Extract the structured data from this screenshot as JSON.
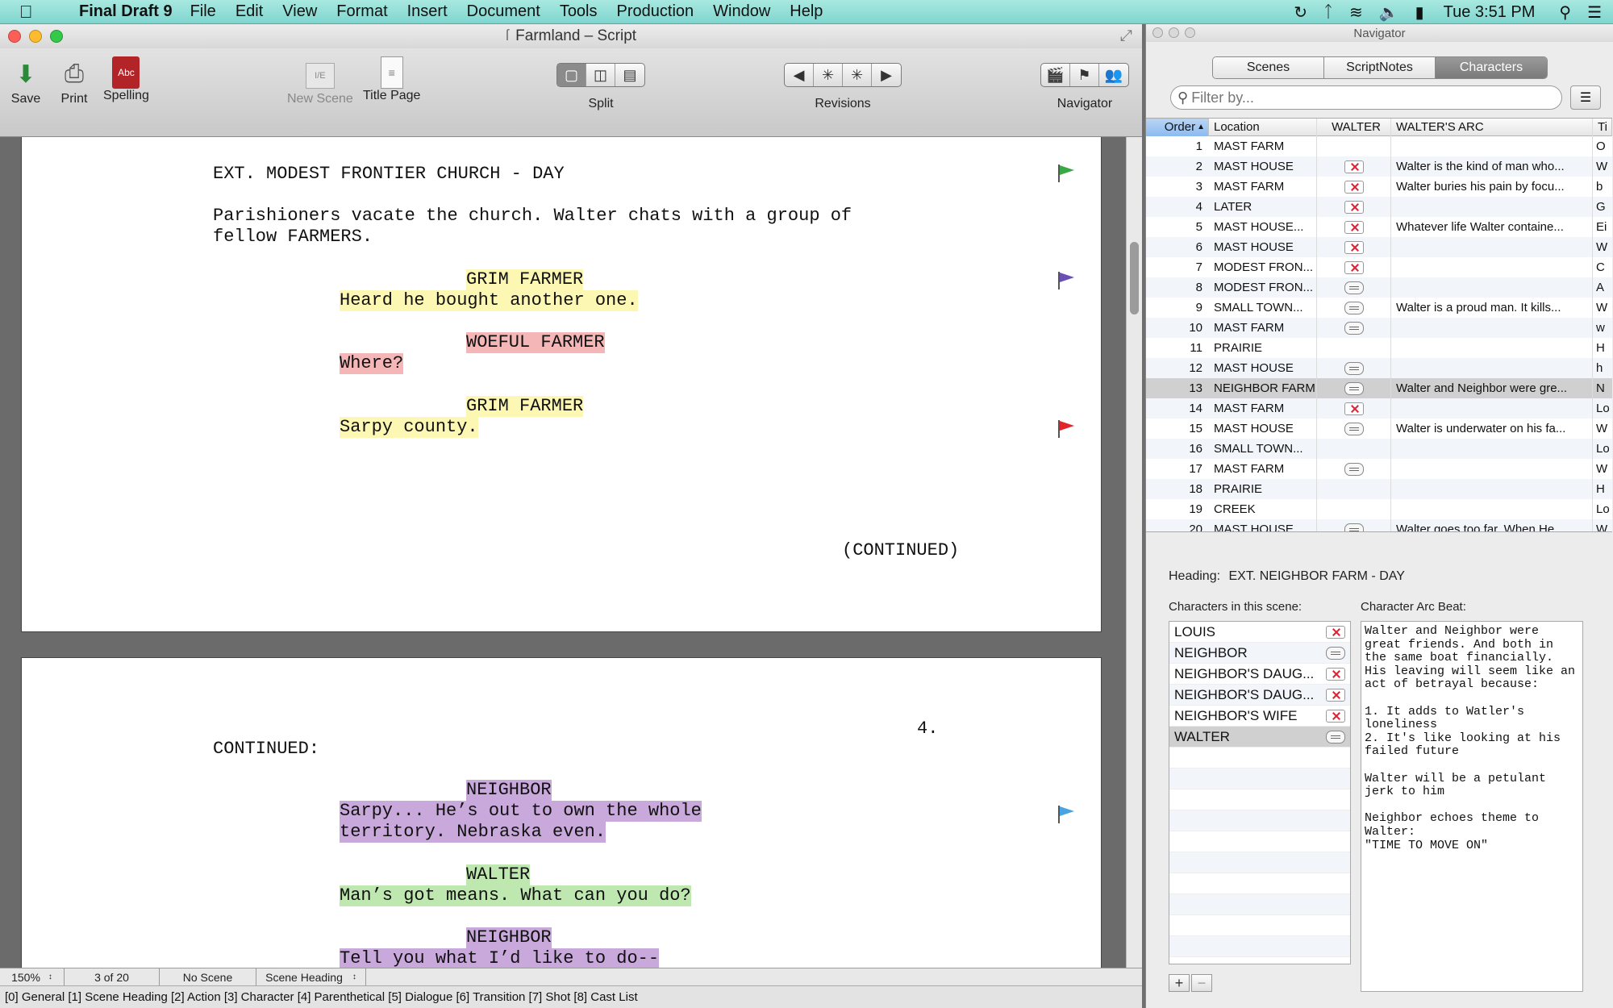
{
  "menubar": {
    "app_name": "Final Draft 9",
    "items": [
      "File",
      "Edit",
      "View",
      "Format",
      "Insert",
      "Document",
      "Tools",
      "Production",
      "Window",
      "Help"
    ],
    "clock": "Tue 3:51 PM"
  },
  "script_window": {
    "title": "Farmland – Script",
    "toolbar": {
      "save": "Save",
      "print": "Print",
      "spelling": "Spelling",
      "new_scene": "New Scene",
      "new_scene_icon_text": "I/E",
      "title_page": "Title Page",
      "split": "Split",
      "revisions": "Revisions",
      "navigator": "Navigator"
    },
    "page1": {
      "heading": "EXT. MODEST FRONTIER CHURCH - DAY",
      "action_1": "Parishioners vacate the church. Walter chats with a group of",
      "action_2": "fellow FARMERS.",
      "char_1": "GRIM FARMER",
      "dial_1": "Heard he bought another one.",
      "char_2": "WOEFUL FARMER",
      "dial_2": "Where?",
      "char_3": "GRIM FARMER",
      "dial_3": "Sarpy county.",
      "continued": "(CONTINUED)",
      "flag_colors": [
        "#3aa845",
        "#6a4fb5",
        "#e0262b"
      ]
    },
    "page2": {
      "page_number": "4.",
      "continued": "CONTINUED:",
      "char_1": "NEIGHBOR",
      "dial_1a": "Sarpy... He’s out to own the whole",
      "dial_1b": "territory. Nebraska even.",
      "char_2": "WALTER",
      "dial_2": "Man’s got means. What can you do?",
      "char_3": "NEIGHBOR",
      "dial_3": "Tell you what I’d like to do--",
      "flag_color": "#4aa3e0"
    },
    "status": {
      "zoom": "150%",
      "page": "3 of 20",
      "scene": "No Scene",
      "element": "Scene Heading"
    },
    "format_bar": "[0] General [1] Scene Heading [2] Action [3] Character [4] Parenthetical [5] Dialogue [6] Transition [7] Shot [8] Cast List"
  },
  "navigator": {
    "title": "Navigator",
    "tabs": [
      "Scenes",
      "ScriptNotes",
      "Characters"
    ],
    "active_tab": "Characters",
    "filter_placeholder": "Filter by...",
    "columns": [
      "Order",
      "Location",
      "WALTER",
      "WALTER'S ARC",
      "Ti"
    ],
    "rows": [
      {
        "order": "1",
        "location": "MAST FARM",
        "walter": "",
        "arc": "",
        "ti": "O"
      },
      {
        "order": "2",
        "location": "MAST HOUSE",
        "walter": "x",
        "arc": "Walter is the kind of man who...",
        "ti": "W"
      },
      {
        "order": "3",
        "location": "MAST FARM",
        "walter": "x",
        "arc": "Walter buries his pain by focu...",
        "ti": "b"
      },
      {
        "order": "4",
        "location": "LATER",
        "walter": "x",
        "arc": "",
        "ti": "G"
      },
      {
        "order": "5",
        "location": "MAST HOUSE...",
        "walter": "x",
        "arc": "Whatever life Walter containe...",
        "ti": "Ei"
      },
      {
        "order": "6",
        "location": "MAST HOUSE",
        "walter": "x",
        "arc": "",
        "ti": "W"
      },
      {
        "order": "7",
        "location": "MODEST FRON...",
        "walter": "x",
        "arc": "",
        "ti": "C"
      },
      {
        "order": "8",
        "location": "MODEST FRON...",
        "walter": "note",
        "arc": "",
        "ti": "A"
      },
      {
        "order": "9",
        "location": "SMALL TOWN...",
        "walter": "note",
        "arc": "Walter is a proud man. It kills...",
        "ti": "W"
      },
      {
        "order": "10",
        "location": "MAST FARM",
        "walter": "note",
        "arc": "",
        "ti": "w"
      },
      {
        "order": "11",
        "location": "PRAIRIE",
        "walter": "",
        "arc": "",
        "ti": "H"
      },
      {
        "order": "12",
        "location": "MAST HOUSE",
        "walter": "note",
        "arc": "",
        "ti": "h"
      },
      {
        "order": "13",
        "location": "NEIGHBOR FARM",
        "walter": "note",
        "arc": "Walter and Neighbor were gre...",
        "ti": "N"
      },
      {
        "order": "14",
        "location": "MAST FARM",
        "walter": "x",
        "arc": "",
        "ti": "Lo"
      },
      {
        "order": "15",
        "location": "MAST HOUSE",
        "walter": "note",
        "arc": "Walter is underwater on his fa...",
        "ti": "W"
      },
      {
        "order": "16",
        "location": "SMALL TOWN...",
        "walter": "",
        "arc": "",
        "ti": "Lo"
      },
      {
        "order": "17",
        "location": "MAST FARM",
        "walter": "note",
        "arc": "",
        "ti": "W"
      },
      {
        "order": "18",
        "location": "PRAIRIE",
        "walter": "",
        "arc": "",
        "ti": "H"
      },
      {
        "order": "19",
        "location": "CREEK",
        "walter": "",
        "arc": "",
        "ti": "Lo"
      },
      {
        "order": "20",
        "location": "MAST HOUSE",
        "walter": "note",
        "arc": "Walter goes too far. When He...",
        "ti": "W"
      }
    ],
    "selected_row": "13",
    "heading_label": "Heading:",
    "heading_value": "EXT. NEIGHBOR FARM - DAY",
    "chars_label": "Characters in this scene:",
    "arc_label": "Character Arc Beat:",
    "characters": [
      {
        "name": "LOUIS",
        "status": "x"
      },
      {
        "name": "NEIGHBOR",
        "status": "note"
      },
      {
        "name": "NEIGHBOR'S DAUG...",
        "status": "x"
      },
      {
        "name": "NEIGHBOR'S DAUG...",
        "status": "x"
      },
      {
        "name": "NEIGHBOR'S WIFE",
        "status": "x"
      },
      {
        "name": "WALTER",
        "status": "note"
      }
    ],
    "selected_character": "WALTER",
    "arc_text": "Walter and Neighbor were great friends. And both in the same boat financially. His leaving will seem like an act of betrayal because:\n\n1. It adds to Watler's loneliness\n2. It's like looking at his failed future\n\nWalter will be a petulant jerk to him\n\nNeighbor echoes theme to Walter:\n\"TIME TO MOVE ON\"",
    "add_label": "+",
    "remove_label": "−"
  }
}
